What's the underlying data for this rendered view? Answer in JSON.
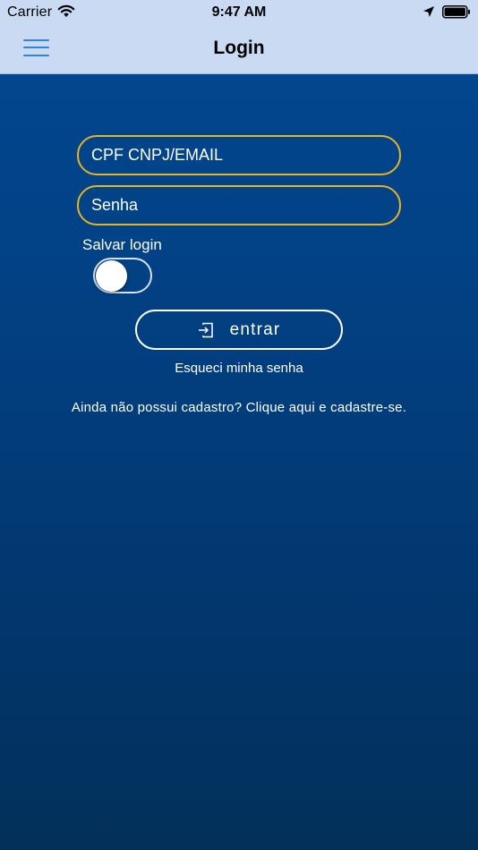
{
  "status_bar": {
    "carrier": "Carrier",
    "time": "9:47 AM",
    "icons": [
      "wifi-icon",
      "location-arrow-icon",
      "battery-icon"
    ]
  },
  "nav": {
    "title": "Login",
    "menu_icon": "hamburger-menu-icon"
  },
  "form": {
    "cpf_placeholder": "CPF CNPJ/EMAIL",
    "cpf_value": "",
    "senha_placeholder": "Senha",
    "senha_value": "",
    "save_login_label": "Salvar login",
    "save_login_on": false,
    "submit_label": "entrar",
    "submit_icon": "login-icon",
    "forgot_password": "Esqueci minha senha",
    "signup_prompt": "Ainda não possui cadastro? Clique aqui e cadastre-se."
  },
  "colors": {
    "nav_background": "#c9daf2",
    "menu_icon": "#2f86d8",
    "field_border": "#e6b422",
    "background_top": "#02468f",
    "background_bottom": "#023059",
    "text": "#ffffff"
  }
}
